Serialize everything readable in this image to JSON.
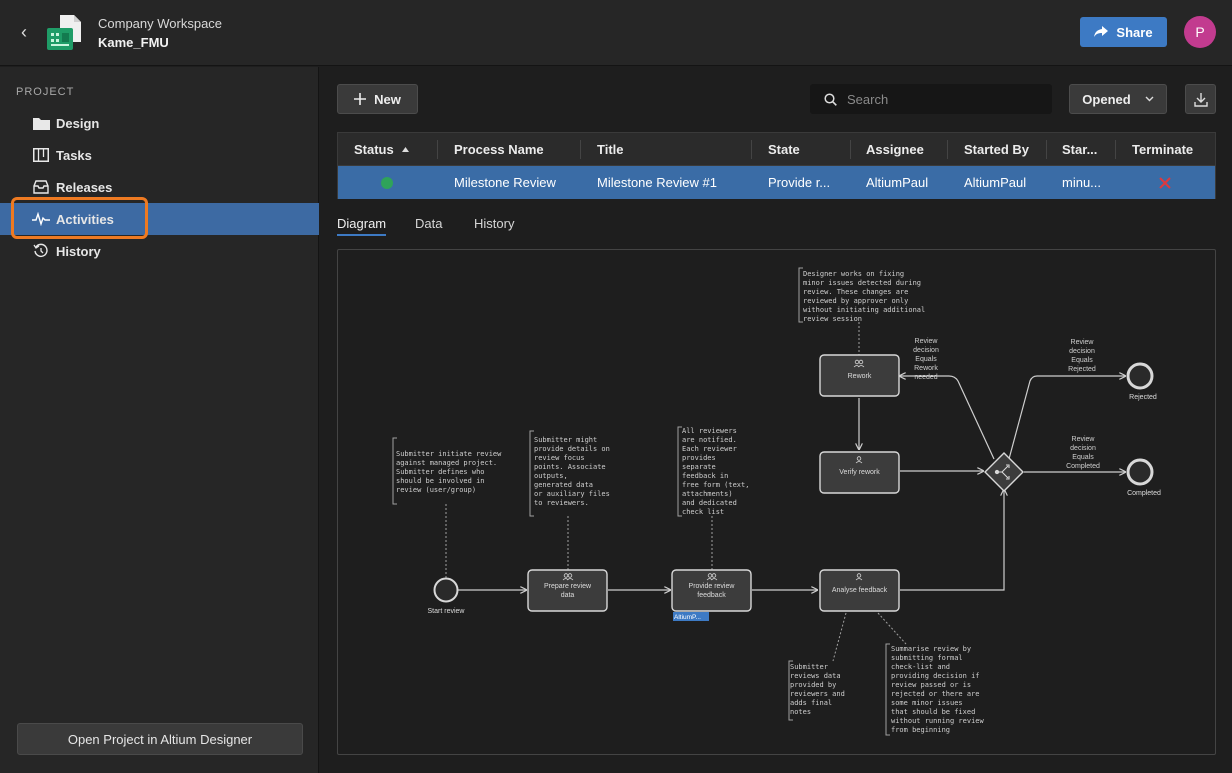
{
  "header": {
    "workspace": "Company Workspace",
    "project": "Kame_FMU",
    "share_label": "Share",
    "avatar_initial": "P"
  },
  "sidebar": {
    "caption": "PROJECT",
    "items": [
      {
        "label": "Design",
        "icon": "folder-icon"
      },
      {
        "label": "Tasks",
        "icon": "board-icon"
      },
      {
        "label": "Releases",
        "icon": "tray-icon"
      },
      {
        "label": "Activities",
        "icon": "pulse-icon",
        "active": true
      },
      {
        "label": "History",
        "icon": "history-icon"
      }
    ],
    "open_button": "Open Project in Altium Designer"
  },
  "toolbar": {
    "new_label": "New",
    "search_placeholder": "Search",
    "filter_value": "Opened"
  },
  "table": {
    "headers": [
      "Status",
      "Process Name",
      "Title",
      "State",
      "Assignee",
      "Started By",
      "Star...",
      "Terminate"
    ],
    "row": {
      "process_name": "Milestone Review",
      "title": "Milestone Review #1",
      "state": "Provide r...",
      "assignee": "AltiumPaul",
      "started_by": "AltiumPaul",
      "started": "minu..."
    }
  },
  "tabs": [
    "Diagram",
    "Data",
    "History"
  ],
  "diagram": {
    "nodes": {
      "start": "Start review",
      "prepare": [
        "Prepare review",
        "data"
      ],
      "provide": [
        "Provide review",
        "feedback"
      ],
      "assignee_tag": "AltiumP...",
      "analyse": "Analyse feedback",
      "rework": "Rework",
      "verify": "Verify rework",
      "rejected": "Rejected",
      "completed": "Completed"
    },
    "edge_labels": {
      "rework": [
        "Review",
        "decision",
        "Equals",
        "Rework",
        "needed"
      ],
      "rejected": [
        "Review",
        "decision",
        "Equals",
        "Rejected"
      ],
      "completed": [
        "Review",
        "decision",
        "Equals",
        "Completed"
      ]
    },
    "annotations": {
      "submitter_initiate": [
        "Submitter initiate review",
        "against managed project.",
        "Submitter defines who",
        "should be involved in",
        "review (user/group)"
      ],
      "submitter_might": [
        "Submitter might",
        "provide details on",
        "review focus",
        "points. Associate",
        "outputs,",
        "generated data",
        "or auxiliary files",
        "to reviewers."
      ],
      "all_reviewers": [
        "All reviewers",
        "are notified.",
        "Each reviewer",
        "provides",
        "separate",
        "feedback in",
        "free form (text,",
        "attachments)",
        "and dedicated",
        "check list"
      ],
      "designer_works": [
        "Designer works on fixing",
        "minor issues detected during",
        "review. These changes are",
        "reviewed by approver only",
        "without initiating additional",
        "review session"
      ],
      "submitter_reviews": [
        "Submitter",
        "reviews data",
        "provided by",
        "reviewers and",
        "adds final",
        "notes"
      ],
      "summarise": [
        "Summarise review by",
        "submitting formal",
        "check-list and",
        "providing decision if",
        "review passed or is",
        "rejected or there are",
        "some minor issues",
        "that should be fixed",
        "without running review",
        "from beginning"
      ]
    }
  }
}
